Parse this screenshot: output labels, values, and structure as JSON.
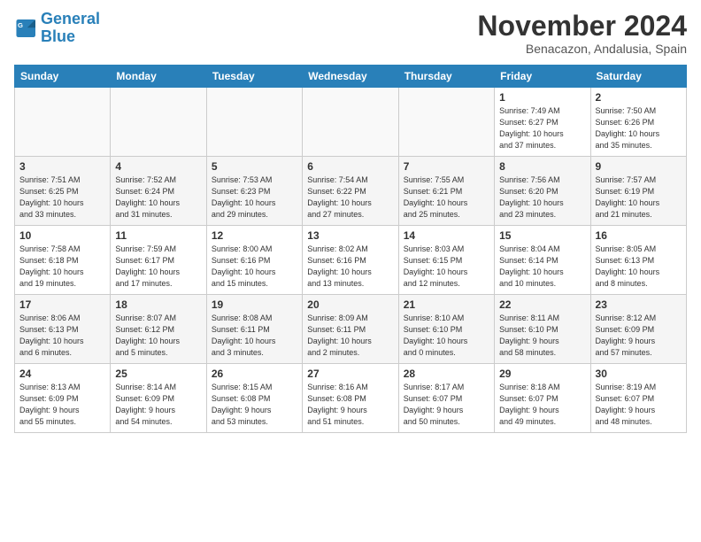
{
  "logo": {
    "line1": "General",
    "line2": "Blue"
  },
  "title": "November 2024",
  "subtitle": "Benacazon, Andalusia, Spain",
  "days_header": [
    "Sunday",
    "Monday",
    "Tuesday",
    "Wednesday",
    "Thursday",
    "Friday",
    "Saturday"
  ],
  "weeks": [
    [
      {
        "day": "",
        "info": ""
      },
      {
        "day": "",
        "info": ""
      },
      {
        "day": "",
        "info": ""
      },
      {
        "day": "",
        "info": ""
      },
      {
        "day": "",
        "info": ""
      },
      {
        "day": "1",
        "info": "Sunrise: 7:49 AM\nSunset: 6:27 PM\nDaylight: 10 hours\nand 37 minutes."
      },
      {
        "day": "2",
        "info": "Sunrise: 7:50 AM\nSunset: 6:26 PM\nDaylight: 10 hours\nand 35 minutes."
      }
    ],
    [
      {
        "day": "3",
        "info": "Sunrise: 7:51 AM\nSunset: 6:25 PM\nDaylight: 10 hours\nand 33 minutes."
      },
      {
        "day": "4",
        "info": "Sunrise: 7:52 AM\nSunset: 6:24 PM\nDaylight: 10 hours\nand 31 minutes."
      },
      {
        "day": "5",
        "info": "Sunrise: 7:53 AM\nSunset: 6:23 PM\nDaylight: 10 hours\nand 29 minutes."
      },
      {
        "day": "6",
        "info": "Sunrise: 7:54 AM\nSunset: 6:22 PM\nDaylight: 10 hours\nand 27 minutes."
      },
      {
        "day": "7",
        "info": "Sunrise: 7:55 AM\nSunset: 6:21 PM\nDaylight: 10 hours\nand 25 minutes."
      },
      {
        "day": "8",
        "info": "Sunrise: 7:56 AM\nSunset: 6:20 PM\nDaylight: 10 hours\nand 23 minutes."
      },
      {
        "day": "9",
        "info": "Sunrise: 7:57 AM\nSunset: 6:19 PM\nDaylight: 10 hours\nand 21 minutes."
      }
    ],
    [
      {
        "day": "10",
        "info": "Sunrise: 7:58 AM\nSunset: 6:18 PM\nDaylight: 10 hours\nand 19 minutes."
      },
      {
        "day": "11",
        "info": "Sunrise: 7:59 AM\nSunset: 6:17 PM\nDaylight: 10 hours\nand 17 minutes."
      },
      {
        "day": "12",
        "info": "Sunrise: 8:00 AM\nSunset: 6:16 PM\nDaylight: 10 hours\nand 15 minutes."
      },
      {
        "day": "13",
        "info": "Sunrise: 8:02 AM\nSunset: 6:16 PM\nDaylight: 10 hours\nand 13 minutes."
      },
      {
        "day": "14",
        "info": "Sunrise: 8:03 AM\nSunset: 6:15 PM\nDaylight: 10 hours\nand 12 minutes."
      },
      {
        "day": "15",
        "info": "Sunrise: 8:04 AM\nSunset: 6:14 PM\nDaylight: 10 hours\nand 10 minutes."
      },
      {
        "day": "16",
        "info": "Sunrise: 8:05 AM\nSunset: 6:13 PM\nDaylight: 10 hours\nand 8 minutes."
      }
    ],
    [
      {
        "day": "17",
        "info": "Sunrise: 8:06 AM\nSunset: 6:13 PM\nDaylight: 10 hours\nand 6 minutes."
      },
      {
        "day": "18",
        "info": "Sunrise: 8:07 AM\nSunset: 6:12 PM\nDaylight: 10 hours\nand 5 minutes."
      },
      {
        "day": "19",
        "info": "Sunrise: 8:08 AM\nSunset: 6:11 PM\nDaylight: 10 hours\nand 3 minutes."
      },
      {
        "day": "20",
        "info": "Sunrise: 8:09 AM\nSunset: 6:11 PM\nDaylight: 10 hours\nand 2 minutes."
      },
      {
        "day": "21",
        "info": "Sunrise: 8:10 AM\nSunset: 6:10 PM\nDaylight: 10 hours\nand 0 minutes."
      },
      {
        "day": "22",
        "info": "Sunrise: 8:11 AM\nSunset: 6:10 PM\nDaylight: 9 hours\nand 58 minutes."
      },
      {
        "day": "23",
        "info": "Sunrise: 8:12 AM\nSunset: 6:09 PM\nDaylight: 9 hours\nand 57 minutes."
      }
    ],
    [
      {
        "day": "24",
        "info": "Sunrise: 8:13 AM\nSunset: 6:09 PM\nDaylight: 9 hours\nand 55 minutes."
      },
      {
        "day": "25",
        "info": "Sunrise: 8:14 AM\nSunset: 6:09 PM\nDaylight: 9 hours\nand 54 minutes."
      },
      {
        "day": "26",
        "info": "Sunrise: 8:15 AM\nSunset: 6:08 PM\nDaylight: 9 hours\nand 53 minutes."
      },
      {
        "day": "27",
        "info": "Sunrise: 8:16 AM\nSunset: 6:08 PM\nDaylight: 9 hours\nand 51 minutes."
      },
      {
        "day": "28",
        "info": "Sunrise: 8:17 AM\nSunset: 6:07 PM\nDaylight: 9 hours\nand 50 minutes."
      },
      {
        "day": "29",
        "info": "Sunrise: 8:18 AM\nSunset: 6:07 PM\nDaylight: 9 hours\nand 49 minutes."
      },
      {
        "day": "30",
        "info": "Sunrise: 8:19 AM\nSunset: 6:07 PM\nDaylight: 9 hours\nand 48 minutes."
      }
    ]
  ]
}
